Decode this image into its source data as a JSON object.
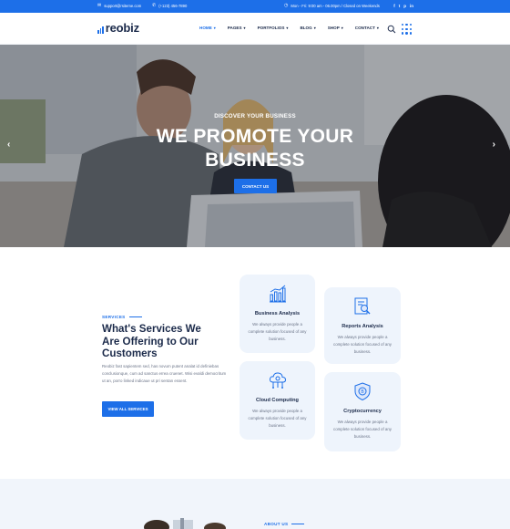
{
  "colors": {
    "accent": "#1d6fe8",
    "dark": "#1b2a4a",
    "card_bg": "#eef4fc"
  },
  "topbar": {
    "email": "support@rsiteme.com",
    "phone": "(+123) 456-7890",
    "hours": "Mon - Fri: 9:00 am - 06.00pm / Closed on Weekends",
    "social": [
      "f",
      "t",
      "p",
      "in"
    ]
  },
  "header": {
    "logo": "reobiz",
    "nav": [
      {
        "label": "HOME",
        "active": true
      },
      {
        "label": "PAGES"
      },
      {
        "label": "PORTFOLIOS"
      },
      {
        "label": "BLOG"
      },
      {
        "label": "SHOP"
      },
      {
        "label": "CONTACT"
      }
    ]
  },
  "hero": {
    "subtitle": "DISCOVER YOUR BUSINESS",
    "title_line1": "WE PROMOTE YOUR",
    "title_line2": "BUSINESS",
    "cta": "CONTACT US",
    "prev": "‹",
    "next": "›"
  },
  "services": {
    "tag": "SERVICES",
    "title": "What's Services We Are Offering to Our Customers",
    "description": "Reobiz fast sapientem sed, has novum putent analat id definiebas conclusionque, cum ad sanctus errea cruenet. Wisi evaldi democritum ut an, porro linked indicaue ut pri sentan essent.",
    "button": "VIEW ALL SERVICES",
    "cards": [
      {
        "icon": "chart-bars-icon",
        "title": "Business Analysis",
        "desc": "We always provide people a complete solution focused of any business."
      },
      {
        "icon": "report-search-icon",
        "title": "Reports Analysis",
        "desc": "We always provide people a complete solution focused of any business."
      },
      {
        "icon": "cloud-computing-icon",
        "title": "Cloud Computing",
        "desc": "We always provide people a complete solution focused of any business."
      },
      {
        "icon": "cryptocurrency-icon",
        "title": "Cryptocurrency",
        "desc": "We always provide people a complete solution focused of any business."
      }
    ]
  },
  "about": {
    "tag": "ABOUT US"
  }
}
